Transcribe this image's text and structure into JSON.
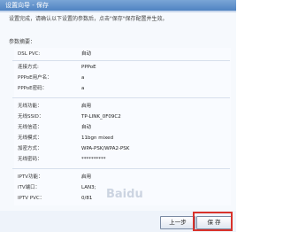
{
  "window": {
    "title": "设置向导 - 保存"
  },
  "notice": "设置完成，请确认以下设置的参数后，点击\"保存\"保存配置并生效。",
  "section_title": "参数摘要：",
  "rows_group1": [
    {
      "key": "DSL PVC:",
      "value": "自动"
    }
  ],
  "rows_group2": [
    {
      "key": "连接方式:",
      "value": "PPPoE"
    },
    {
      "key": "PPPoE用户名：",
      "value": "a"
    },
    {
      "key": "PPPoE密码：",
      "value": "a"
    }
  ],
  "rows_group3": [
    {
      "key": "无线功能：",
      "value": "启用"
    },
    {
      "key": "无线SSID：",
      "value": "TP-LINK_0F09C2"
    },
    {
      "key": "无线信道：",
      "value": "自动"
    },
    {
      "key": "无线模式：",
      "value": "11bgn mixed"
    },
    {
      "key": "加密方式：",
      "value": "WPA-PSK/WPA2-PSK"
    },
    {
      "key": "无线密码：",
      "value": "**********"
    }
  ],
  "rows_group4": [
    {
      "key": "IPTV功能：",
      "value": "启用"
    },
    {
      "key": "iTV端口：",
      "value": "LAN3;"
    },
    {
      "key": "IPTV PVC：",
      "value": "0/81"
    }
  ],
  "buttons": {
    "prev_label": "上一步",
    "save_label": "保 存"
  },
  "watermark": "Baidu"
}
